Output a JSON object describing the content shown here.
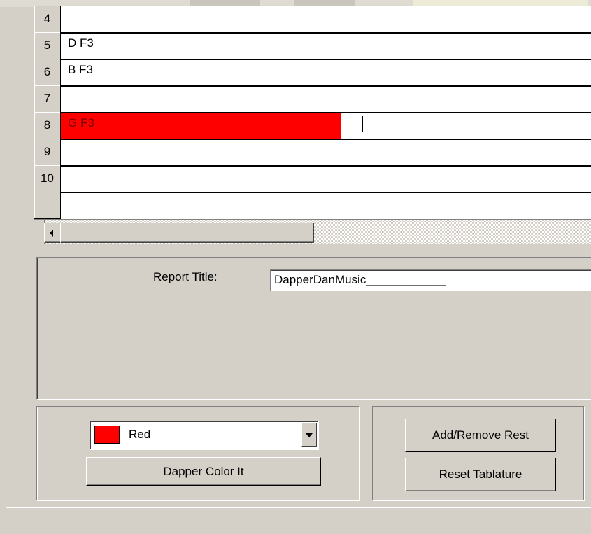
{
  "grid": {
    "rows": [
      {
        "num": "4",
        "text": "",
        "highlight": false
      },
      {
        "num": "5",
        "text": "D F3",
        "highlight": false
      },
      {
        "num": "6",
        "text": "B F3",
        "highlight": false
      },
      {
        "num": "7",
        "text": "",
        "highlight": false
      },
      {
        "num": "8",
        "text": "G F3",
        "highlight": true
      },
      {
        "num": "9",
        "text": "",
        "highlight": false
      },
      {
        "num": "10",
        "text": "",
        "highlight": false
      },
      {
        "num": "",
        "text": "",
        "highlight": false
      }
    ],
    "highlight_color": "#fe0000"
  },
  "report": {
    "label": "Report Title:",
    "value": "DapperDanMusic____________"
  },
  "color_picker": {
    "selected": "Red",
    "swatch_color": "#fe0000",
    "apply_label": "Dapper Color It"
  },
  "actions": {
    "add_remove_rest": "Add/Remove Rest",
    "reset_tablature": "Reset Tablature"
  },
  "icons": {
    "scroll_left": "arrow-left-icon",
    "dropdown": "chevron-down-icon"
  }
}
